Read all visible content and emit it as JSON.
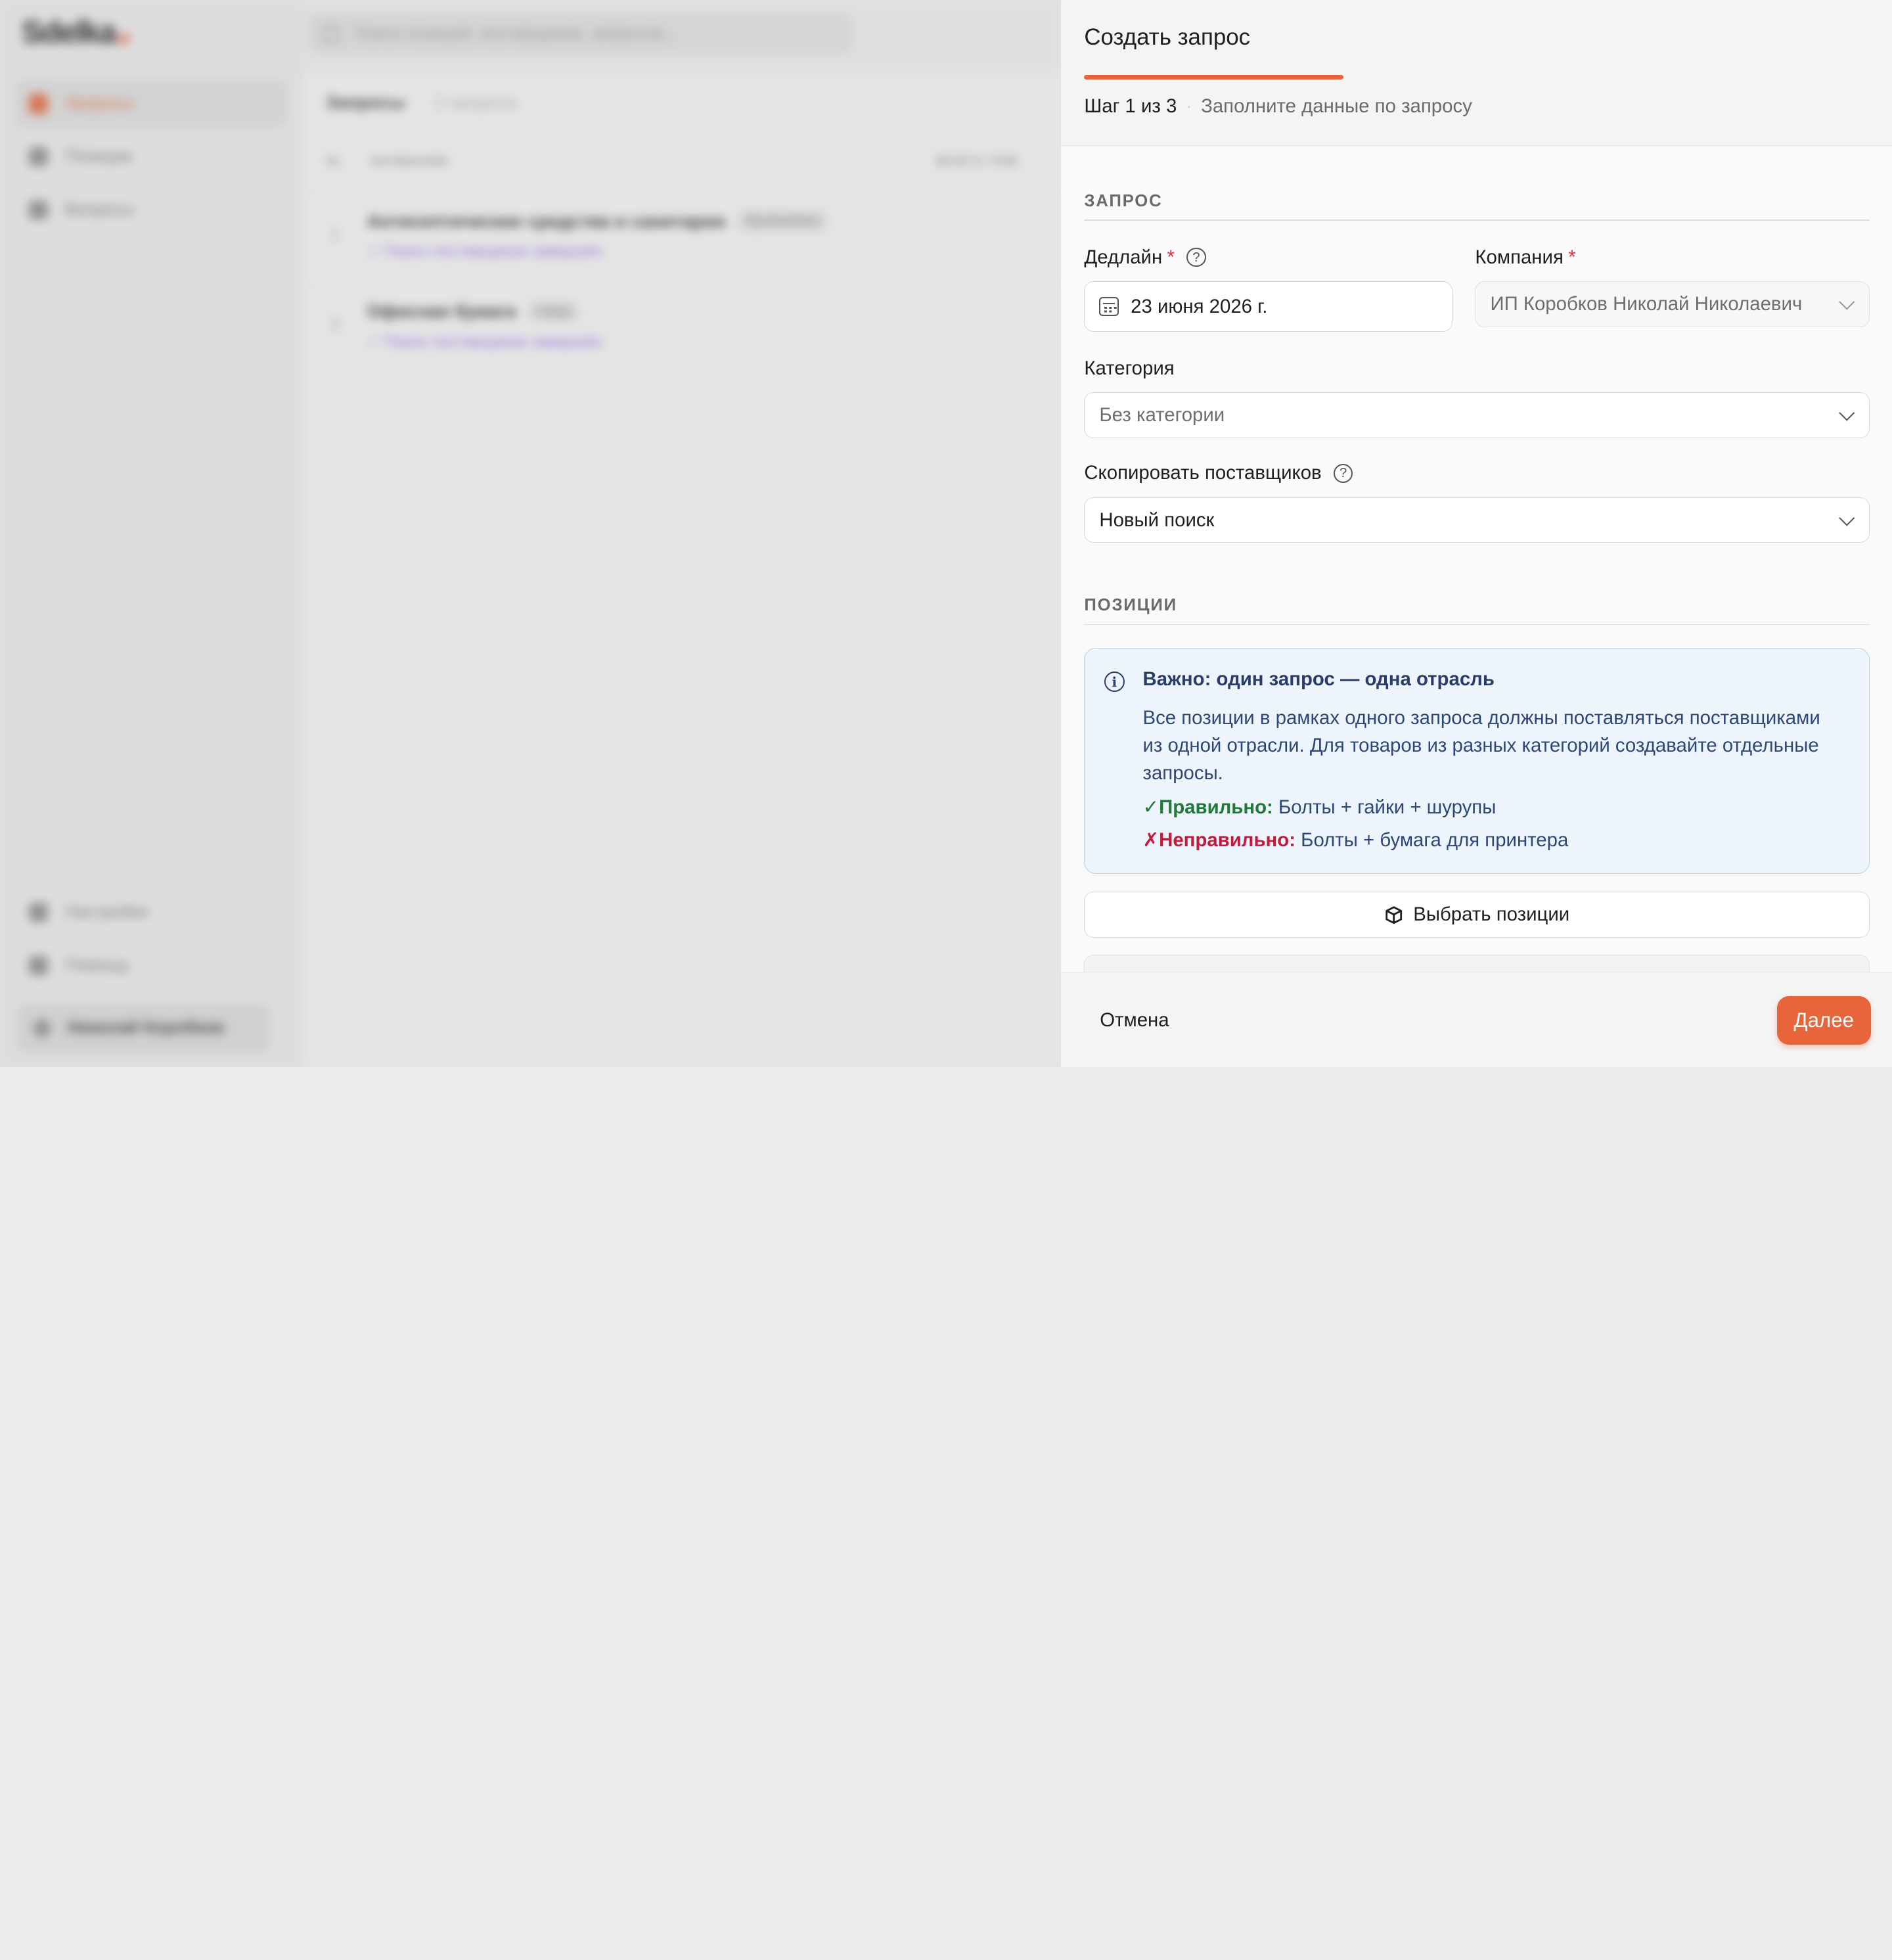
{
  "background": {
    "logo": "Sdelka",
    "logo_suffix": ".ai",
    "search_placeholder": "Поиск позиций, поставщиков, запросов...",
    "nav": [
      {
        "label": "Запросы",
        "active": true
      },
      {
        "label": "Позиции",
        "active": false
      },
      {
        "label": "Вопросы",
        "active": false
      }
    ],
    "nav_bottom": [
      {
        "label": "Настройки"
      },
      {
        "label": "Помощь"
      }
    ],
    "user": "Николай Коробков",
    "main_title": "Запросы",
    "main_count": "2 запроса",
    "columns": [
      "№",
      "НАЗВАНИЕ",
      "ВСЕГО ТОВ"
    ],
    "rows": [
      {
        "num": "1",
        "title": "Антисептические средства и санитарии",
        "badge": "Выполнено",
        "link": "✓ Поиск поставщиков завершён"
      },
      {
        "num": "2",
        "title": "Офисная бумага",
        "badge": "Свод",
        "link": "✓ Поиск поставщиков завершён"
      }
    ]
  },
  "drawer": {
    "title": "Создать запрос",
    "step": "Шаг 1 из 3",
    "step_separator": "·",
    "step_hint": "Заполните данные по запросу",
    "section_request": "ЗАПРОС",
    "deadline_label": "Дедлайн",
    "deadline_value": "23 июня 2026 г.",
    "company_label": "Компания",
    "company_value": "ИП Коробков Николай Николаевич",
    "category_label": "Категория",
    "category_value": "Без категории",
    "copy_label": "Скопировать поставщиков",
    "copy_value": "Новый поиск",
    "section_positions": "ПОЗИЦИИ",
    "info_title": "Важно: один запрос — одна отрасль",
    "info_text": "Все позиции в рамках одного запроса должны поставляться поставщиками из одной отрасли. Для товаров из разных категорий создавайте отдельные запросы.",
    "good_label": "✓Правильно:",
    "good_text": " Болты + гайки + шурупы",
    "bad_label": "✗Неправильно:",
    "bad_text": " Болты + бумага для принтера",
    "select_positions": "Выбрать позиции",
    "required_mark": "*",
    "help_mark": "?",
    "info_mark": "i"
  },
  "footer": {
    "cancel": "Отмена",
    "next": "Далее"
  },
  "colors": {
    "accent": "#e8643a",
    "info_bg": "#eef4fb",
    "success": "#1f7a3a",
    "danger": "#c41a3b",
    "required": "#e0343d"
  }
}
